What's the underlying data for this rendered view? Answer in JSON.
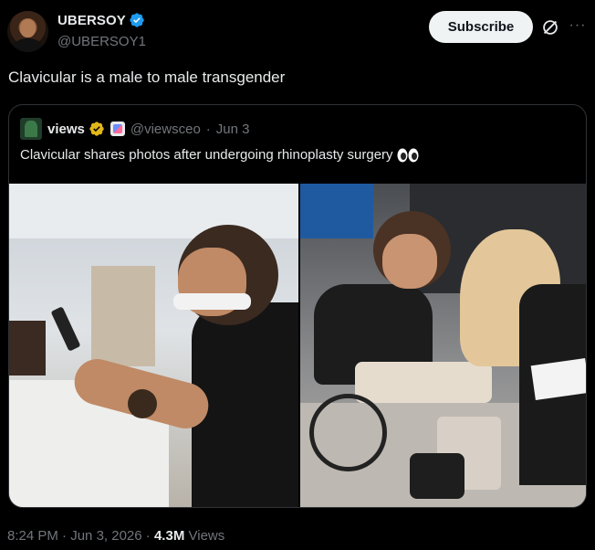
{
  "author": {
    "display_name": "UBERSOY",
    "handle": "@UBERSOY1"
  },
  "actions": {
    "subscribe_label": "Subscribe",
    "more_label": "···"
  },
  "tweet": {
    "text": "Clavicular is a male to male transgender",
    "time": "8:24 PM",
    "date": "Jun 3, 2026",
    "views_count": "4.3M",
    "views_label": "Views",
    "separator": "·"
  },
  "quote": {
    "display_name": "views",
    "handle": "@viewsceo",
    "date": "Jun 3",
    "separator": "·",
    "text": "Clavicular shares photos after undergoing rhinoplasty surgery"
  },
  "colors": {
    "background": "#000000",
    "text_primary": "#e7e9ea",
    "text_secondary": "#71767b",
    "verified_blue": "#1d9bf0",
    "verified_gold": "#e2b719",
    "border": "#2f3336",
    "subscribe_bg": "#eff3f4"
  },
  "icons": {
    "verified": "verified-badge-icon",
    "gold": "gold-checkmark-icon",
    "grok": "grok-icon",
    "more": "more-icon",
    "eyes": "eyes-emoji-icon"
  }
}
